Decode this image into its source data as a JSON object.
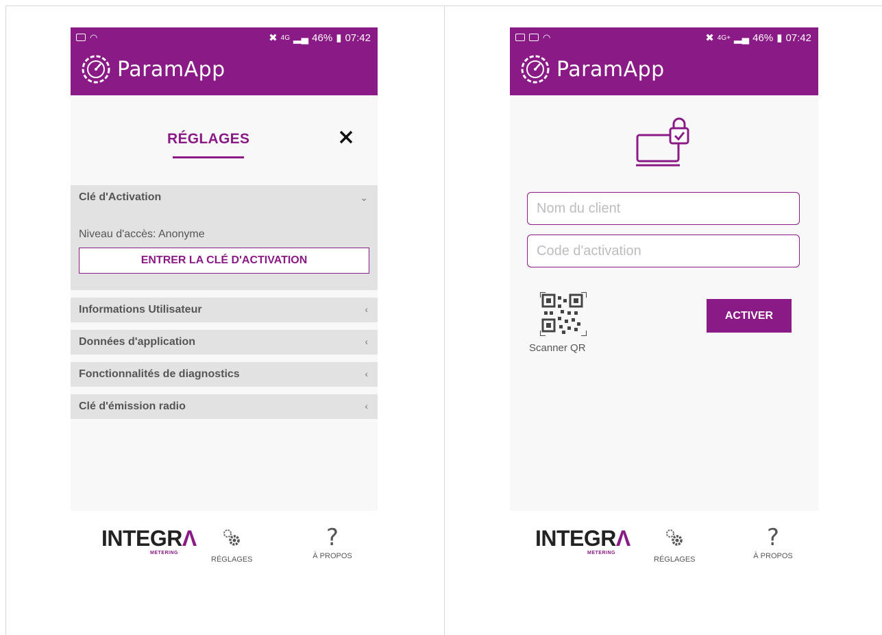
{
  "app_title": "ParamApp",
  "colors": {
    "brand": "#8a1a85",
    "panel": "#e2e2e2",
    "background": "#f8f8f8"
  },
  "left_screen": {
    "status": {
      "network": "4G",
      "battery": "46%",
      "time": "07:42"
    },
    "settings_title": "RÉGLAGES",
    "close_icon": "close-icon",
    "activation_section": {
      "label": "Clé d'Activation",
      "chevron": "⌄",
      "access_level": "Niveau d'accès: Anonyme",
      "enter_key_button": "ENTRER LA CLÉ D'ACTIVATION"
    },
    "sections": [
      {
        "label": "Informations Utilisateur",
        "chevron": "‹"
      },
      {
        "label": "Données d'application",
        "chevron": "‹"
      },
      {
        "label": "Fonctionnalités de diagnostics",
        "chevron": "‹"
      },
      {
        "label": "Clé d'émission radio",
        "chevron": "‹"
      }
    ]
  },
  "right_screen": {
    "status": {
      "network": "4G+",
      "battery": "46%",
      "time": "07:42"
    },
    "client_name_placeholder": "Nom du client",
    "activation_code_placeholder": "Code d'activation",
    "qr_label": "Scanner QR",
    "activate_button": "ACTIVER"
  },
  "bottom_nav": {
    "logo_text": "INTEGR",
    "logo_sub": "METERING",
    "settings_label": "RÉGLAGES",
    "about_label": "À PROPOS",
    "about_glyph": "?"
  }
}
